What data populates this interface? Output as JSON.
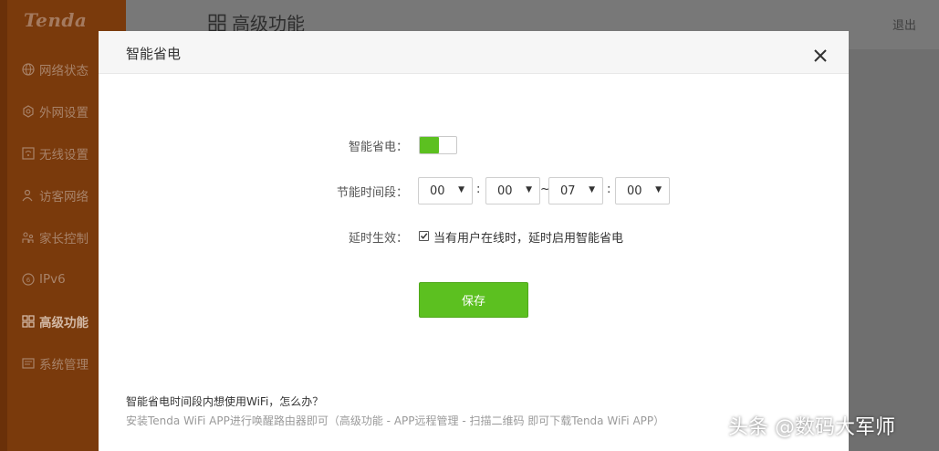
{
  "app": {
    "logo": "Tenda",
    "page_title": "高级功能",
    "logout": "退出"
  },
  "sidebar": {
    "items": [
      {
        "label": "网络状态",
        "icon": "globe-icon"
      },
      {
        "label": "外网设置",
        "icon": "gear-icon"
      },
      {
        "label": "无线设置",
        "icon": "wifi-icon"
      },
      {
        "label": "访客网络",
        "icon": "guest-user-icon"
      },
      {
        "label": "家长控制",
        "icon": "parent-control-icon"
      },
      {
        "label": "IPv6",
        "icon": "ipv6-icon"
      },
      {
        "label": "高级功能",
        "icon": "grid-icon",
        "active": true
      },
      {
        "label": "系统管理",
        "icon": "system-icon"
      }
    ]
  },
  "modal": {
    "title": "智能省电",
    "close_icon": "close-icon",
    "power_saving_label": "智能省电：",
    "power_saving_enabled": true,
    "time_period_label": "节能时间段：",
    "start_hour": "00",
    "start_minute": "00",
    "range_separator": "~",
    "end_hour": "07",
    "end_minute": "00",
    "time_colon": ":",
    "delay_label": "延时生效：",
    "delay_checked": true,
    "delay_text": "当有用户在线时，延时启用智能省电",
    "save_label": "保存",
    "faq_question": "智能省电时间段内想使用WiFi，怎么办？",
    "faq_answer": "安装Tenda WiFi APP进行唤醒路由器即可（高级功能 - APP远程管理 - 扫描二维码 即可下载Tenda WiFi APP）"
  },
  "watermark": "头条 @数码大军师",
  "colors": {
    "accent_green": "#5cc020",
    "sidebar_brown": "#7a3a0c"
  }
}
